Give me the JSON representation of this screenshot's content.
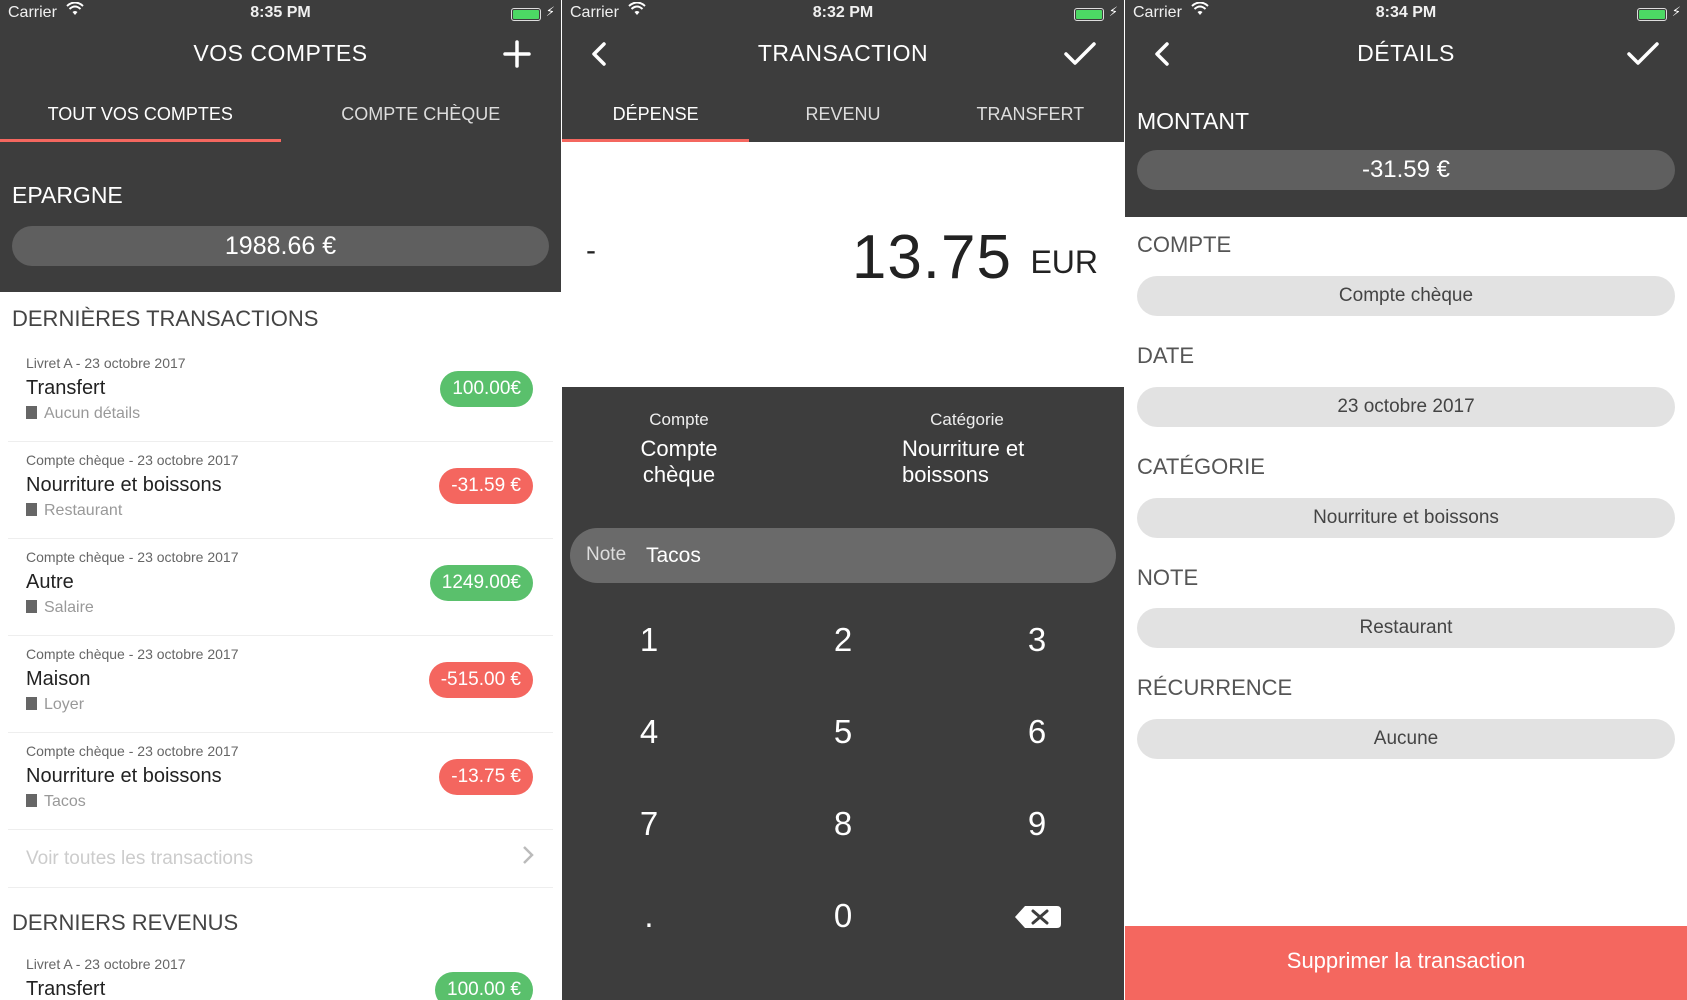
{
  "status": [
    {
      "carrier": "Carrier",
      "time": "8:35 PM"
    },
    {
      "carrier": "Carrier",
      "time": "8:32 PM"
    },
    {
      "carrier": "Carrier",
      "time": "8:34 PM"
    }
  ],
  "accounts_screen": {
    "title": "VOS COMPTES",
    "tabs": [
      "TOUT VOS COMPTES",
      "COMPTE CHÈQUE"
    ],
    "balance_label": "EPARGNE",
    "balance_value": "1988.66 €",
    "recent_title": "DERNIÈRES TRANSACTIONS",
    "transactions": [
      {
        "meta": "Livret A - 23 octobre 2017",
        "name": "Transfert",
        "detail": "Aucun détails",
        "amount": "100.00€",
        "positive": true
      },
      {
        "meta": "Compte chèque - 23 octobre 2017",
        "name": "Nourriture et boissons",
        "detail": "Restaurant",
        "amount": "-31.59 €",
        "positive": false
      },
      {
        "meta": "Compte chèque - 23 octobre 2017",
        "name": "Autre",
        "detail": "Salaire",
        "amount": "1249.00€",
        "positive": true
      },
      {
        "meta": "Compte chèque - 23 octobre 2017",
        "name": "Maison",
        "detail": "Loyer",
        "amount": "-515.00 €",
        "positive": false
      },
      {
        "meta": "Compte chèque - 23 octobre 2017",
        "name": "Nourriture et boissons",
        "detail": "Tacos",
        "amount": "-13.75 €",
        "positive": false
      }
    ],
    "see_all": "Voir toutes les transactions",
    "income_title": "DERNIERS REVENUS",
    "income": [
      {
        "meta": "Livret A - 23 octobre 2017",
        "name": "Transfert",
        "amount": "100.00 €",
        "positive": true
      }
    ]
  },
  "transaction_screen": {
    "title": "TRANSACTION",
    "tabs": [
      "DÉPENSE",
      "REVENU",
      "TRANSFERT"
    ],
    "sign": "-",
    "amount": "13.75",
    "currency": "EUR",
    "account_label": "Compte",
    "account_value": "Compte chèque",
    "category_label": "Catégorie",
    "category_value_line1": "Nourriture et",
    "category_value_line2": "boissons",
    "note_label": "Note",
    "note_value": "Tacos",
    "keys": [
      "1",
      "2",
      "3",
      "4",
      "5",
      "6",
      "7",
      "8",
      "9",
      ".",
      "0"
    ]
  },
  "details_screen": {
    "title": "DÉTAILS",
    "amount_label": "MONTANT",
    "amount_value": "-31.59 €",
    "fields": [
      {
        "label": "COMPTE",
        "value": "Compte chèque"
      },
      {
        "label": "DATE",
        "value": "23 octobre 2017"
      },
      {
        "label": "CATÉGORIE",
        "value": "Nourriture et boissons"
      },
      {
        "label": "NOTE",
        "value": "Restaurant"
      },
      {
        "label": "RÉCURRENCE",
        "value": "Aucune"
      }
    ],
    "delete_label": "Supprimer la transaction"
  },
  "colors": {
    "header": "#3d3d3d",
    "accent": "#f4675f",
    "positive": "#5ac06c",
    "negative": "#f4665f"
  },
  "icons": [
    "wifi-icon",
    "battery-icon",
    "plus-icon",
    "back-icon",
    "check-icon",
    "document-icon",
    "chevron-right-icon",
    "backspace-icon"
  ]
}
